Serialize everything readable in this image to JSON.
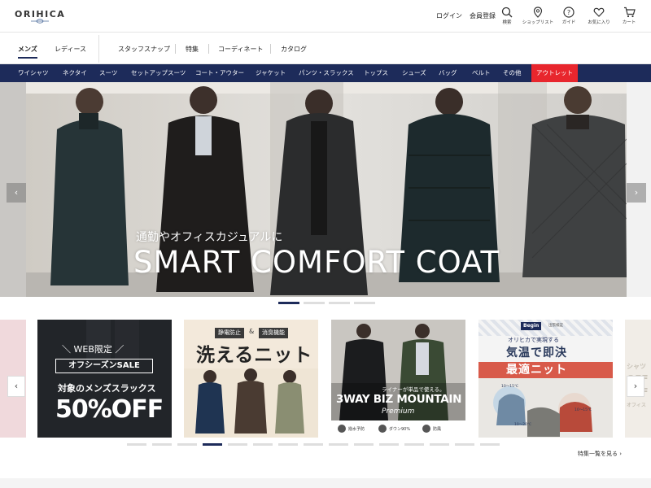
{
  "brand": {
    "logo_text": "ORIHICA"
  },
  "header": {
    "login": "ログイン",
    "register": "会員登録",
    "icons": [
      {
        "icon": "search-icon",
        "label": "検索"
      },
      {
        "icon": "map-pin-icon",
        "label": "ショップリスト"
      },
      {
        "icon": "help-icon",
        "label": "ガイド"
      },
      {
        "icon": "heart-icon",
        "label": "お気に入り"
      },
      {
        "icon": "cart-icon",
        "label": "カート"
      }
    ]
  },
  "gender_nav": {
    "mens": "メンズ",
    "ladies": "レディース"
  },
  "secondary_nav": [
    "スタッフスナップ",
    "特集",
    "コーディネート",
    "カタログ"
  ],
  "categories": [
    "ワイシャツ",
    "ネクタイ",
    "スーツ",
    "セットアップスーツ",
    "コート・アウター",
    "ジャケット",
    "パンツ・スラックス",
    "トップス",
    "シューズ",
    "バッグ",
    "ベルト",
    "その他",
    "アウトレット"
  ],
  "hero": {
    "subtitle": "通勤やオフィスカジュアルに",
    "title": "SMART COMFORT COAT",
    "prev": "‹",
    "next": "›",
    "slide_count": 4,
    "active_slide": 1
  },
  "features": {
    "card1": {
      "web_only": "＼ WEB限定 ／",
      "box": "オフシーズンSALE",
      "line": "対象のメンズスラックス",
      "big": "50%OFF"
    },
    "card2": {
      "tag1": "静電防止",
      "amp": "&",
      "tag2": "消臭機能",
      "title": "洗えるニット"
    },
    "card3": {
      "small": "ライナーが単品で使える。",
      "title": "3WAY BIZ MOUNTAIN PARKA",
      "premium": "Premium",
      "strip": [
        "撥水予防",
        "ダウン90%",
        "防風"
      ]
    },
    "card4": {
      "logo": "Begin",
      "logo_right": "出張検証",
      "sub": "オリヒカで実現する",
      "title": "気温で即決",
      "band": "最適ニット",
      "temps": [
        "10〜15℃",
        "10〜15℃",
        "10〜20℃"
      ]
    },
    "prev": "‹",
    "next": "›",
    "dot_count": 15,
    "active_dot": 3,
    "more_link": "特集一覧を見る ›",
    "peek_right": [
      "シャツ",
      "OFF",
      "OFF",
      "オフィス"
    ]
  },
  "colors": {
    "navy": "#1d2b5a",
    "outlet_red": "#e8262d"
  }
}
